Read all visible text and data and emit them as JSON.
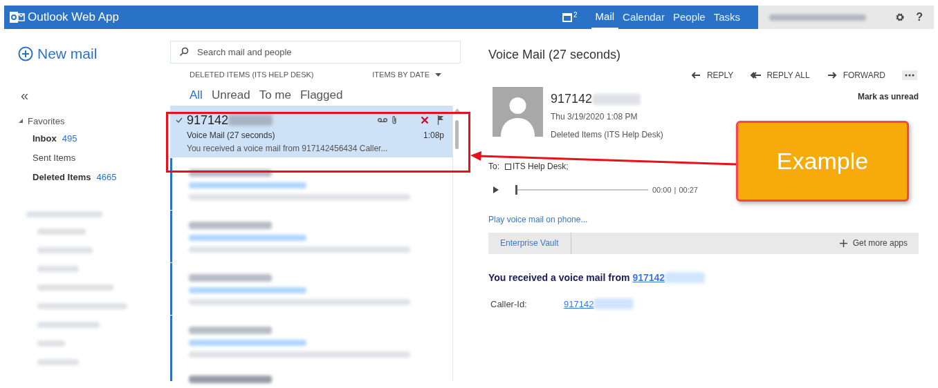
{
  "app": {
    "title": "Outlook Web App"
  },
  "top_nav": {
    "calendar_badge": "2",
    "links": [
      {
        "label": "Mail",
        "selected": true
      },
      {
        "label": "Calendar",
        "selected": false
      },
      {
        "label": "People",
        "selected": false
      },
      {
        "label": "Tasks",
        "selected": false
      }
    ],
    "help": "?"
  },
  "sidebar": {
    "new_mail": "New mail",
    "collapse": "«",
    "favorites": {
      "label": "Favorites",
      "expanded": true,
      "items": [
        {
          "label": "Inbox",
          "count": "495"
        },
        {
          "label": "Sent Items"
        },
        {
          "label": "Deleted Items",
          "count": "4665"
        }
      ]
    }
  },
  "search": {
    "placeholder": "Search mail and people"
  },
  "list_header": {
    "folder": "DELETED ITEMS (ITS HELP DESK)",
    "sort": "ITEMS BY DATE"
  },
  "filters": [
    {
      "label": "All",
      "selected": true
    },
    {
      "label": "Unread",
      "selected": false
    },
    {
      "label": "To me",
      "selected": false
    },
    {
      "label": "Flagged",
      "selected": false
    }
  ],
  "messages": [
    {
      "sender": "917142",
      "subject": "Voice Mail (27 seconds)",
      "preview": "You received a voice mail from 917142456434 Caller...",
      "time": "1:08p",
      "selected": true
    }
  ],
  "reading": {
    "subject": "Voice Mail (27 seconds)",
    "actions": [
      {
        "label": "REPLY",
        "kind": "reply"
      },
      {
        "label": "REPLY ALL",
        "kind": "reply_all"
      },
      {
        "label": "FORWARD",
        "kind": "forward"
      }
    ],
    "mark_unread": "Mark as unread",
    "sender": "917142",
    "date": "Thu 3/19/2020 1:08 PM",
    "folder": "Deleted Items (ITS Help Desk)",
    "to_label": "To:",
    "to": "ITS Help Desk;",
    "player": {
      "level": 0,
      "elapsed": "00:00",
      "separator": "|",
      "total": "00:27"
    },
    "play_on_phone": "Play voice mail on phone...",
    "apps": {
      "items": [
        "Enterprise Vault"
      ],
      "more": "Get more apps"
    },
    "body": {
      "heading": "You received a voice mail from",
      "link": "917142"
    },
    "caller_label": "Caller-Id:",
    "caller": "917142"
  },
  "annotation": {
    "label": "Example"
  }
}
